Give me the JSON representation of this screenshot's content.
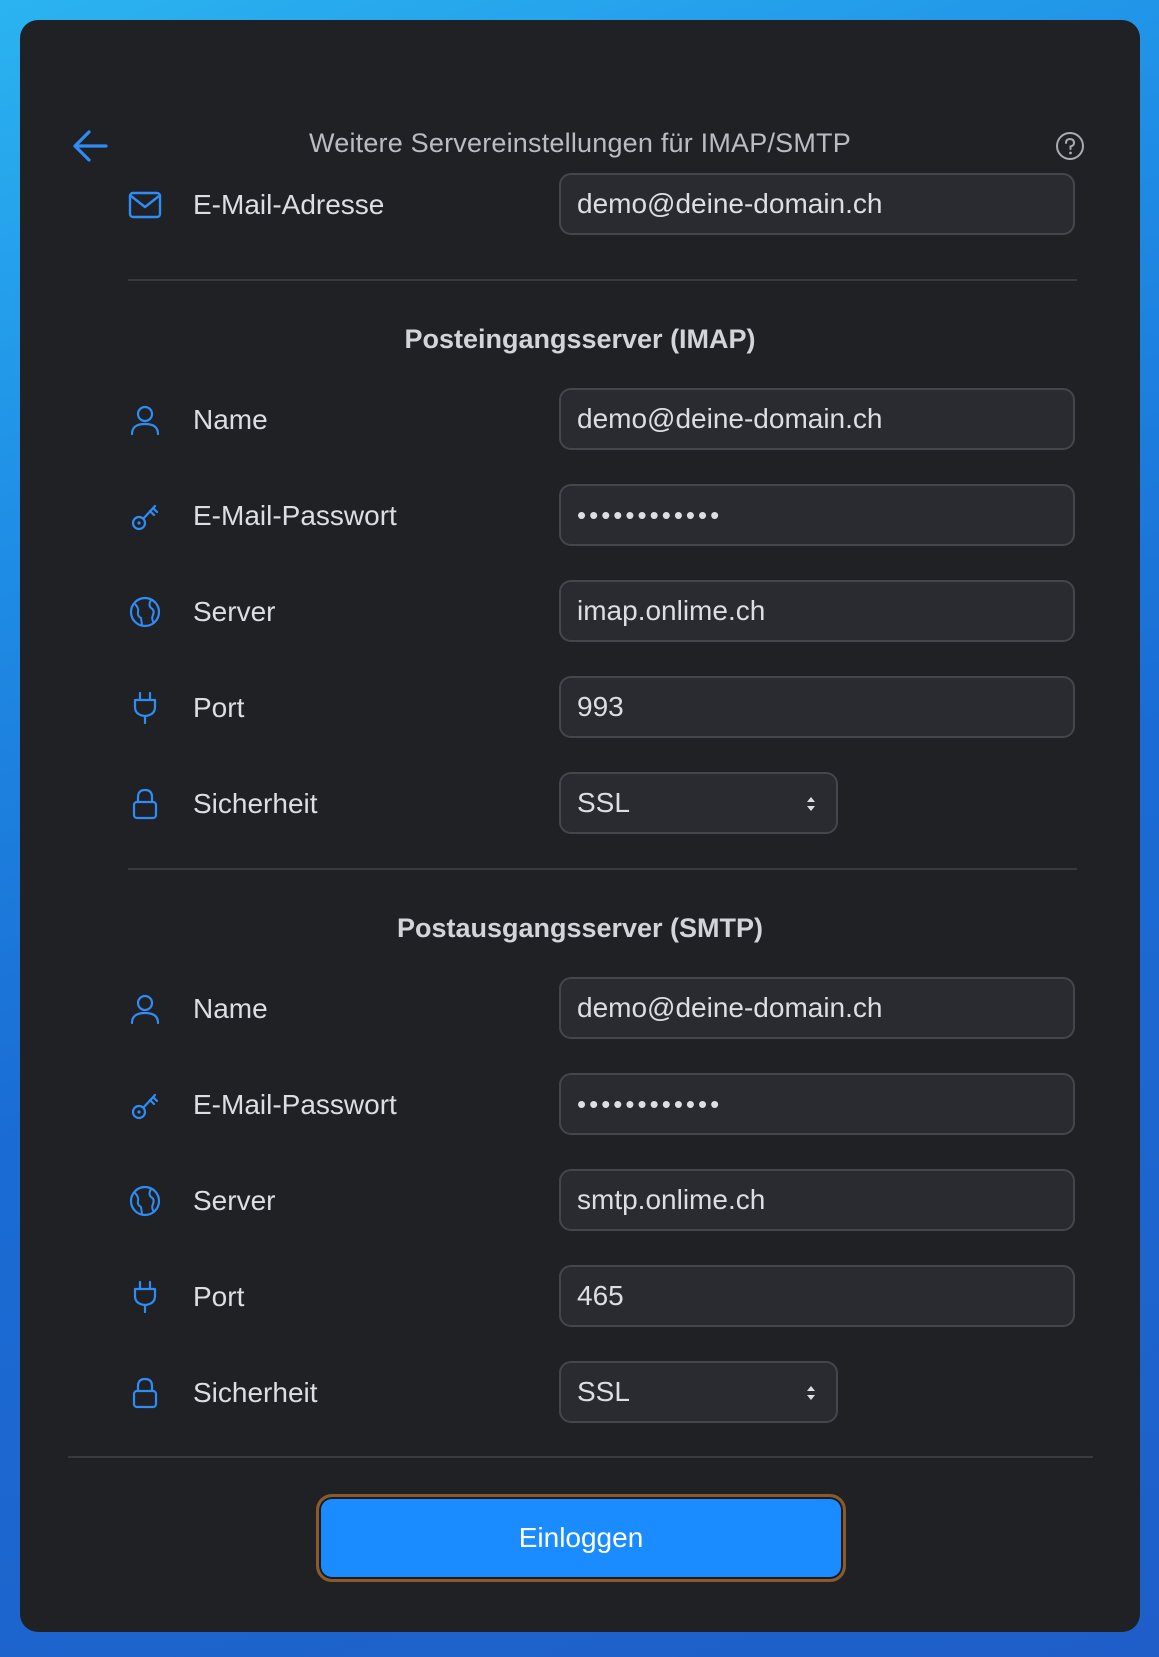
{
  "header": {
    "title": "Weitere Servereinstellungen für IMAP/SMTP",
    "back_icon": "arrow-left-icon",
    "help_icon": "question-circle-icon"
  },
  "email": {
    "label": "E-Mail-Adresse",
    "value": "demo@deine-domain.ch",
    "icon": "envelope-icon"
  },
  "imap": {
    "title": "Posteingangsserver (IMAP)",
    "name_label": "Name",
    "name_value": "demo@deine-domain.ch",
    "password_label": "E-Mail-Passwort",
    "password_value": "••••••••••••",
    "server_label": "Server",
    "server_value": "imap.onlime.ch",
    "port_label": "Port",
    "port_value": "993",
    "security_label": "Sicherheit",
    "security_value": "SSL"
  },
  "smtp": {
    "title": "Postausgangsserver (SMTP)",
    "name_label": "Name",
    "name_value": "demo@deine-domain.ch",
    "password_label": "E-Mail-Passwort",
    "password_value": "••••••••••••",
    "server_label": "Server",
    "server_value": "smtp.onlime.ch",
    "port_label": "Port",
    "port_value": "465",
    "security_label": "Sicherheit",
    "security_value": "SSL"
  },
  "login_button": "Einloggen",
  "colors": {
    "accent": "#1a8cff",
    "icon_blue": "#2f8cf5",
    "panel_bg": "#202125",
    "field_bg": "#2a2b30"
  }
}
